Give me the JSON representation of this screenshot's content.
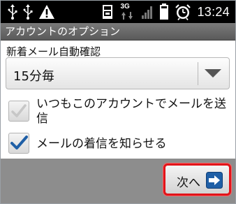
{
  "status_bar": {
    "time": "13:24",
    "network_label": "3G",
    "icons": [
      "usb-icon",
      "usb-icon",
      "warning-icon",
      "sd-card-icon",
      "network-3g-icon",
      "signal-icon",
      "battery-icon",
      "alarm-icon"
    ]
  },
  "title_bar": {
    "title": "アカウントのオプション"
  },
  "settings": {
    "check_frequency_label": "新着メール自動確認",
    "check_frequency_value": "15分毎",
    "options": [
      {
        "label": "いつもこのアカウントでメールを送\n信",
        "checked": false
      },
      {
        "label": "メールの着信を知らせる",
        "checked": true
      }
    ]
  },
  "footer": {
    "next_label": "次へ"
  },
  "colors": {
    "status_bar_bg": "#000000",
    "title_bar_bg": "#666666",
    "highlight_border": "#e2141a",
    "check_mark": "#1f5fa6",
    "next_icon_bg": "#1f5fa6"
  }
}
